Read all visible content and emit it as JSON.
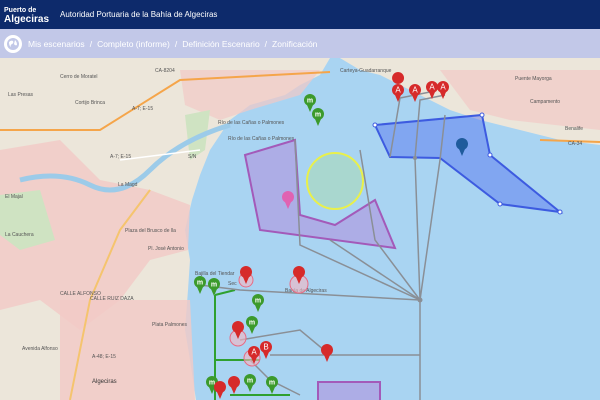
{
  "header": {
    "logo_line1": "Puerto de",
    "logo_line2": "Algeciras",
    "title": "Autoridad Portuaria de la Bahía de Algeciras"
  },
  "breadcrumb": {
    "icon": "globe-icon",
    "items": [
      "Mis escenarios",
      "Completo (informe)",
      "Definición Escenario",
      "Zonificación"
    ],
    "separator": "/"
  },
  "map_labels": {
    "road_ca8204": "CA-8204",
    "cortijo": "Cerro de Moratel",
    "presas": "Las Presas",
    "grupo_cortijo": "Cortijo Brinca",
    "a7_1": "A-7; E-15",
    "a7_2": "A-7; E-15",
    "la_mag": "La Magd",
    "el_mag": "El Majal",
    "rio_canas": "Río de las Cañas o Palmones",
    "rio_canas2": "Río de las Cañas o Palmones",
    "sn": "S/N",
    "carteya": "Carteya-Guadarranque",
    "puente_mayorga": "Puente Mayorga",
    "campamento": "Campamento",
    "benalife": "Benalife",
    "ca34": "CA-34",
    "jose_antonio": "Pl. José Antonio",
    "pinos": "Plaza del Brusco de lla",
    "bajo_tiendar": "Bajilla del Tiendar",
    "bahia": "Bahía de Algeciras",
    "sec": "Sec",
    "calle_alfonso": "CALLE ALFONSO",
    "calle_ruiz": "CALLE RUIZ DAZA",
    "plata": "Plata Palmones",
    "av_alfonso": "Avenida Alfonso",
    "a48": "A-48; E-15",
    "algeciras": "Algeciras",
    "la_cauchera": "La Cauchera"
  },
  "markers": {
    "letter_a": "A",
    "letter_b": "B",
    "letter_m": "m"
  },
  "colors": {
    "header_bg": "#0d2a6b",
    "breadcrumb_bg": "#c2c8e8",
    "sea": "#a9d4f2",
    "land": "#ece6da",
    "purple_zone": "#a35ab9",
    "blue_zone": "#3d5be0",
    "marker_red": "#d62a2a",
    "marker_green": "#3c9a2c",
    "marker_blue": "#1f5b9c",
    "marker_pink": "#e062b2"
  }
}
